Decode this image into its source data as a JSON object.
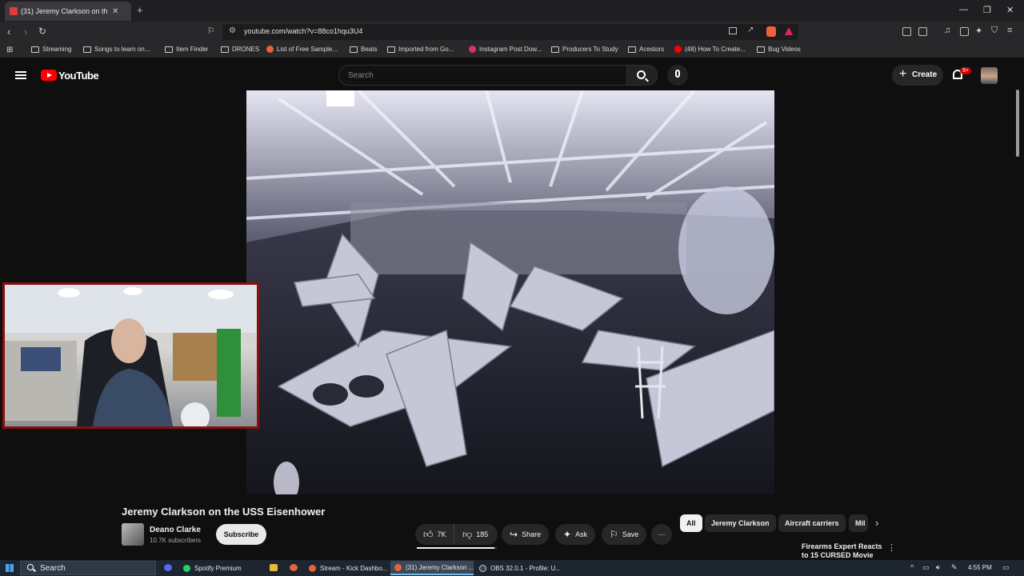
{
  "browser": {
    "tab_title": "(31) Jeremy Clarkson on the USS Eisenhower",
    "url": "youtube.com/watch?v=88co1hqu3U4",
    "bookmarks": [
      {
        "label": "Streaming",
        "type": "folder"
      },
      {
        "label": "Songs to learn on...",
        "type": "folder"
      },
      {
        "label": "Item Finder",
        "type": "folder"
      },
      {
        "label": "DRONES",
        "type": "folder"
      },
      {
        "label": "List of Free Sample...",
        "type": "site",
        "color": "#e8623a"
      },
      {
        "label": "Beats",
        "type": "folder"
      },
      {
        "label": "Imported from Go...",
        "type": "folder"
      },
      {
        "label": "Instagram Post Dow...",
        "type": "site",
        "color": "#d6336c"
      },
      {
        "label": "Producers To Study",
        "type": "folder"
      },
      {
        "label": "Acestors",
        "type": "folder"
      },
      {
        "label": "(48) How To Create...",
        "type": "site",
        "color": "#ff0000"
      },
      {
        "label": "Bug Videos",
        "type": "folder"
      }
    ]
  },
  "youtube": {
    "brand": "YouTube",
    "search_placeholder": "Search",
    "create_label": "Create",
    "notifications_badge": "9+",
    "video": {
      "title": "Jeremy Clarkson on the USS Eisenhower",
      "channel": "Deano Clarke",
      "subscribers": "10.7K subscribers",
      "subscribe_label": "Subscribe",
      "likes": "7K",
      "dislikes": "185",
      "like_ratio": 0.974,
      "share_label": "Share",
      "ask_label": "Ask",
      "save_label": "Save"
    },
    "chips": [
      "All",
      "Jeremy Clarkson",
      "Aircraft carriers",
      "Mil"
    ],
    "recommended": {
      "title": "Firearms Expert Reacts to 15 CURSED Movie"
    }
  },
  "taskbar": {
    "search_label": "Search",
    "apps": [
      {
        "label": "Spotify Premium",
        "color": "#1ed760"
      },
      {
        "label": "Stream - Kick Dashbo...",
        "color": "#e8623a"
      },
      {
        "label": "(31) Jeremy Clarkson ...",
        "color": "#e8623a"
      },
      {
        "label": "OBS 32.0.1 - Profile: U...",
        "color": "#444444"
      }
    ],
    "clock": "4:55 PM"
  }
}
